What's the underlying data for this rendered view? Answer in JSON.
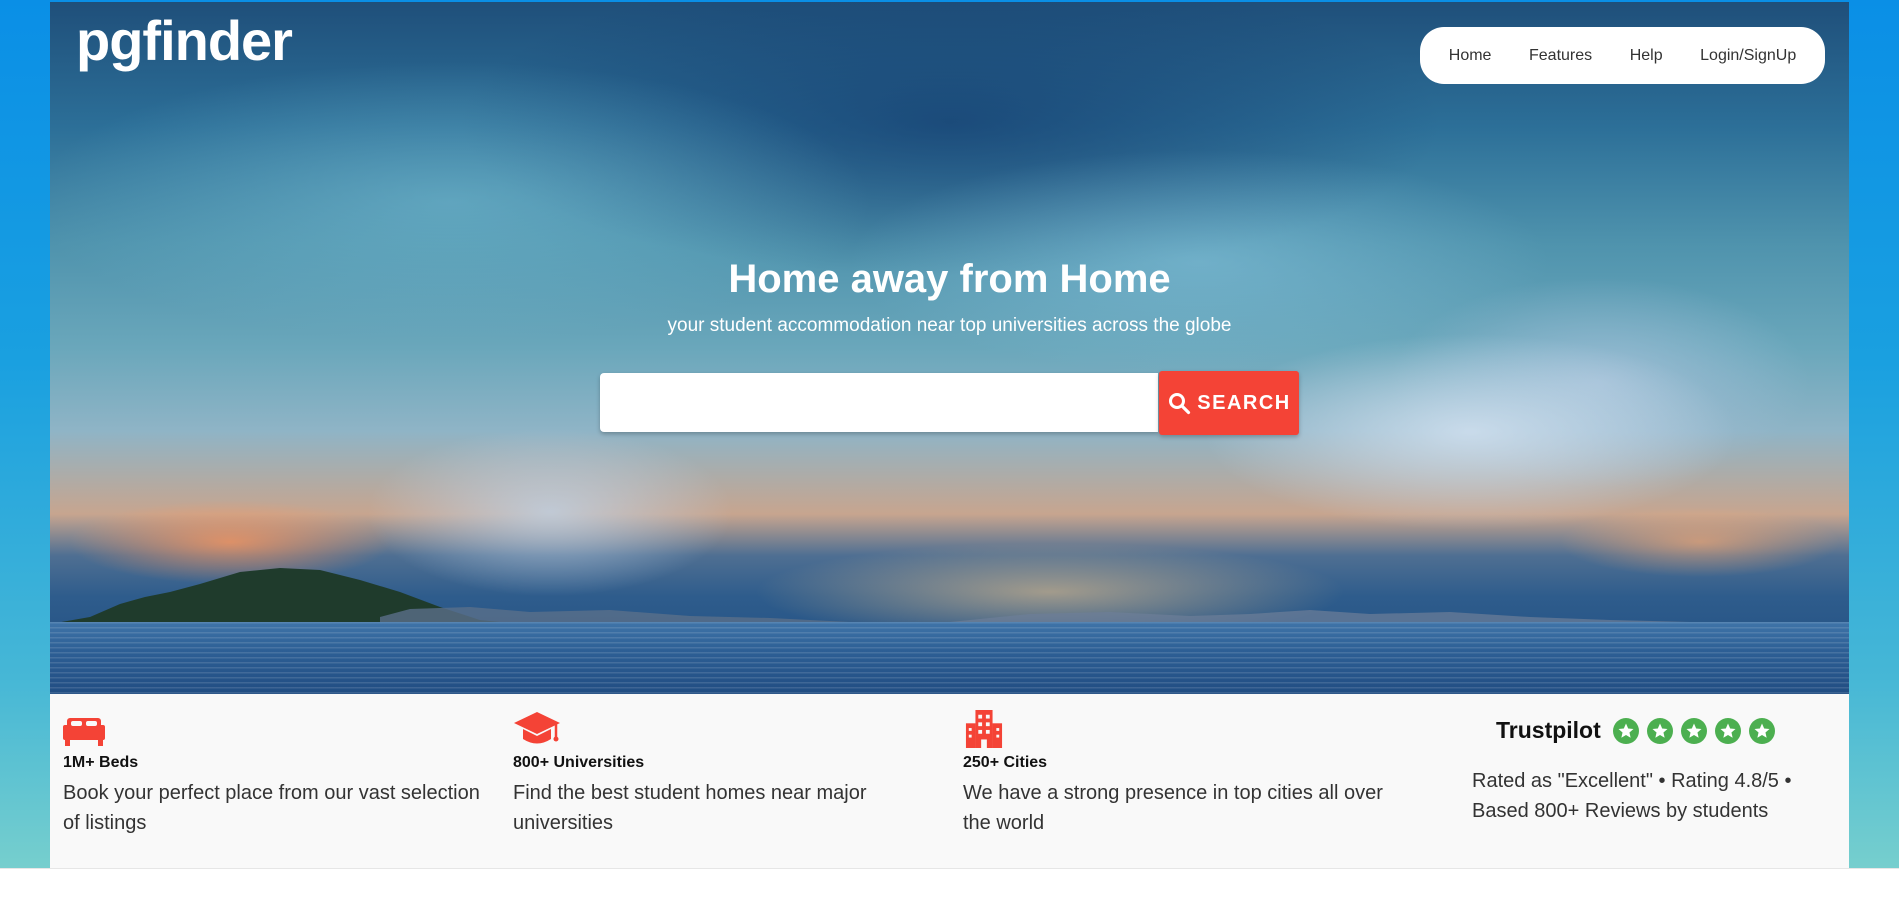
{
  "brand": {
    "logo": "pgfinder"
  },
  "nav": {
    "items": [
      {
        "label": "Home"
      },
      {
        "label": "Features"
      },
      {
        "label": "Help"
      },
      {
        "label": "Login/SignUp"
      }
    ]
  },
  "hero": {
    "title": "Home away from Home",
    "subtitle": "your student accommodation near top universities across the globe",
    "search": {
      "value": "",
      "placeholder": "",
      "button_label": "SEARCH"
    }
  },
  "features": [
    {
      "icon": "bed-icon",
      "title": "1M+ Beds",
      "description": "Book your perfect place from our vast selection of listings"
    },
    {
      "icon": "graduation-cap-icon",
      "title": "800+ Universities",
      "description": "Find the best student homes near major universities"
    },
    {
      "icon": "city-building-icon",
      "title": "250+ Cities",
      "description": "We have a strong presence in top cities all over the world"
    }
  ],
  "trustpilot": {
    "name": "Trustpilot",
    "stars": 5,
    "text": "Rated as \"Excellent\" • Rating 4.8/5 • Based 800+ Reviews by students"
  },
  "colors": {
    "accent": "#f44336",
    "star_green": "#4caf50",
    "outer_background": "#0a8fe6"
  }
}
